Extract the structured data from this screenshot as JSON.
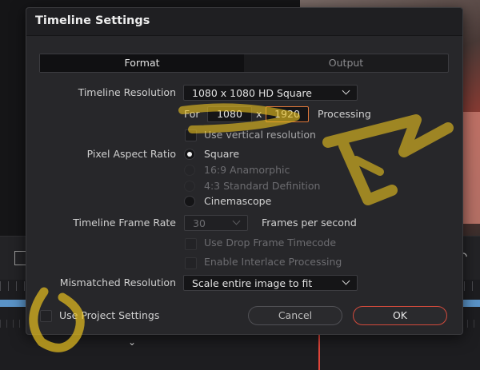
{
  "dialog": {
    "title": "Timeline Settings"
  },
  "tabs": [
    {
      "label": "Format",
      "active": true
    },
    {
      "label": "Output",
      "active": false
    }
  ],
  "resolution": {
    "label": "Timeline Resolution",
    "value": "1080 x 1080 HD Square",
    "for_label": "For",
    "width": "1080",
    "x_label": "x",
    "height": "1920",
    "processing_label": "Processing",
    "vertical_label": "Use vertical resolution"
  },
  "aspect": {
    "label": "Pixel Aspect Ratio",
    "options": [
      {
        "label": "Square",
        "selected": true,
        "enabled": true
      },
      {
        "label": "16:9 Anamorphic",
        "selected": false,
        "enabled": false
      },
      {
        "label": "4:3 Standard Definition",
        "selected": false,
        "enabled": false
      },
      {
        "label": "Cinemascope",
        "selected": false,
        "enabled": true
      }
    ]
  },
  "frame_rate": {
    "label": "Timeline Frame Rate",
    "value": "30",
    "unit": "Frames per second",
    "drop_frame_label": "Use Drop Frame Timecode",
    "interlace_label": "Enable Interlace Processing"
  },
  "mismatch": {
    "label": "Mismatched Resolution",
    "value": "Scale entire image to fit"
  },
  "footer": {
    "project_settings_label": "Use Project Settings",
    "cancel_label": "Cancel",
    "ok_label": "OK"
  },
  "colors": {
    "accent": "#e0783a",
    "ok_border": "#d24a3c",
    "annotation": "#e8c020"
  }
}
